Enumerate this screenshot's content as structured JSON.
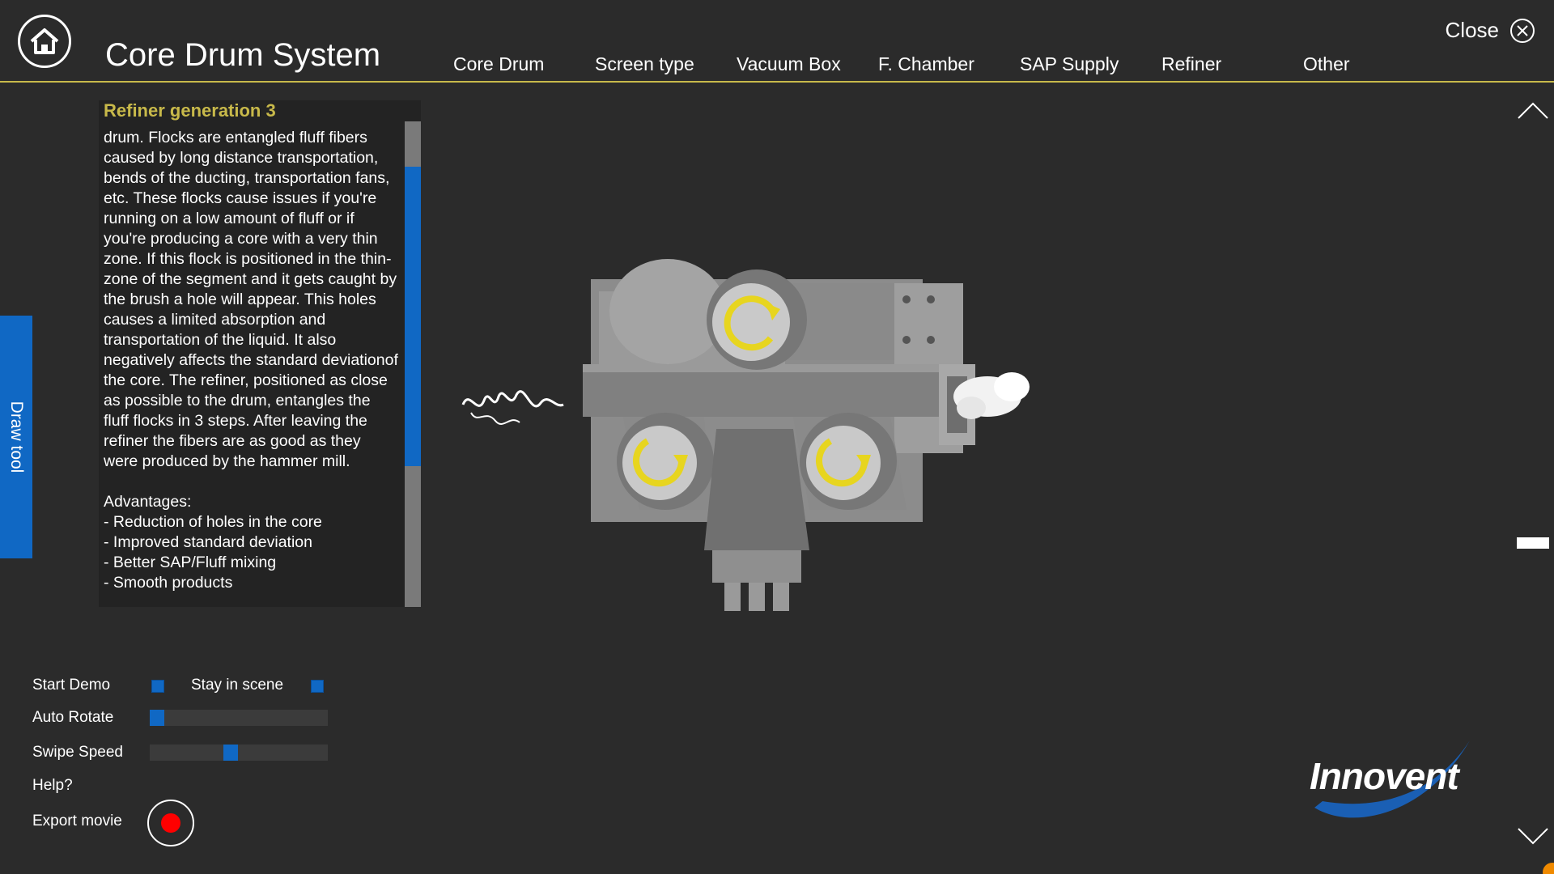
{
  "header": {
    "title": "Core Drum System",
    "close_label": "Close",
    "tabs": [
      {
        "label": "Core Drum"
      },
      {
        "label": "Screen type"
      },
      {
        "label": "Vacuum Box"
      },
      {
        "label": "F. Chamber"
      },
      {
        "label": "SAP Supply"
      },
      {
        "label": "Refiner"
      },
      {
        "label": "Other"
      }
    ]
  },
  "draw_tool": {
    "label": "Draw tool"
  },
  "panel": {
    "title": "Refiner generation 3",
    "body": "drum. Flocks are entangled fluff fibers caused by long distance transportation, bends of the ducting, transportation fans, etc. These flocks cause issues if you're running on a low amount of fluff or if you're producing a core with a very thin zone. If this flock is positioned in the thin-zone of the segment and it gets caught by the brush a hole will appear. This holes causes a limited absorption and transportation of the liquid. It also negatively affects the standard deviationof the core. The refiner, positioned as close as possible to the drum, entangles the fluff flocks in 3 steps. After leaving the refiner the fibers are as good as they were produced by the hammer mill.\n\nAdvantages:\n- Reduction of holes in the core\n- Improved standard deviation\n- Better SAP/Fluff mixing\n- Smooth products"
  },
  "controls": {
    "start_demo": "Start Demo",
    "stay_in_scene": "Stay in scene",
    "auto_rotate": "Auto Rotate",
    "swipe_speed": "Swipe Speed",
    "help": "Help?",
    "export_movie": "Export movie",
    "auto_rotate_level": 0.0,
    "swipe_speed_level": 0.45
  },
  "logo": {
    "text": "Innovent"
  },
  "colors": {
    "accent_blue": "#1068c4",
    "title_gold": "#c8b94a",
    "record_red": "#ff0000",
    "background": "#2b2b2b"
  },
  "icons": {
    "home": "home-icon",
    "close": "close-icon",
    "up": "chevron-up-icon",
    "down": "chevron-down-icon",
    "record": "record-icon"
  }
}
